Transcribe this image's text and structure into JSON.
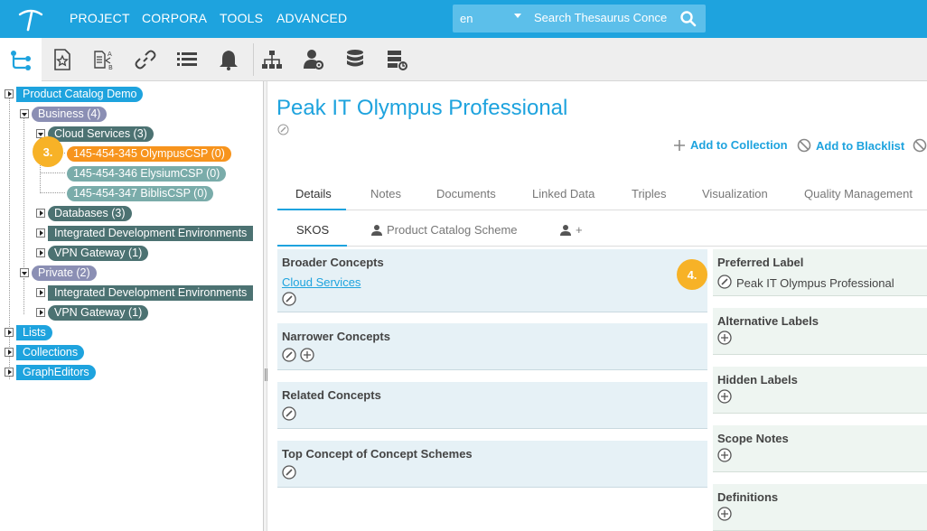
{
  "topbar": {
    "nav": [
      "PROJECT",
      "CORPORA",
      "TOOLS",
      "ADVANCED"
    ],
    "language": "en",
    "search_placeholder": "Search Thesaurus Conce"
  },
  "toolbar": {
    "tools": [
      "hierarchy-icon",
      "star-document-icon",
      "abc-document-icon",
      "link-icon",
      "list-icon",
      "bell-icon",
      "org-chart-icon",
      "user-settings-icon",
      "database-icon",
      "server-icon"
    ]
  },
  "tree": {
    "root": "Product Catalog Demo",
    "business": "Business (4)",
    "cloud_services": "Cloud Services (3)",
    "olympus": "145-454-345 OlympusCSP (0)",
    "elysium": "145-454-346 ElysiumCSP (0)",
    "biblis": "145-454-347 BiblisCSP (0)",
    "databases": "Databases (3)",
    "ide_business": "Integrated Development Environments",
    "vpn_business": "VPN Gateway (1)",
    "private": "Private (2)",
    "ide_private": "Integrated Development Environments",
    "vpn_private": "VPN Gateway (1)",
    "lists": "Lists",
    "collections": "Collections",
    "grapheditors": "GraphEditors"
  },
  "badges": {
    "step3": "3.",
    "step4": "4."
  },
  "concept": {
    "title": "Peak IT Olympus Professional",
    "add_collection": "Add to Collection",
    "add_blacklist": "Add to Blacklist"
  },
  "tabs": [
    "Details",
    "Notes",
    "Documents",
    "Linked Data",
    "Triples",
    "Visualization",
    "Quality Management"
  ],
  "subtabs": {
    "skos": "SKOS",
    "scheme": "Product Catalog Scheme",
    "plus": "+"
  },
  "left_cards": {
    "broader": "Broader Concepts",
    "broader_link": "Cloud Services",
    "narrower": "Narrower Concepts",
    "related": "Related Concepts",
    "top_concept": "Top Concept of Concept Schemes"
  },
  "right_cards": {
    "preferred": "Preferred Label",
    "preferred_value": "Peak IT Olympus Professional",
    "alternative": "Alternative Labels",
    "hidden": "Hidden Labels",
    "scope": "Scope Notes",
    "definitions": "Definitions"
  },
  "colors": {
    "brand": "#1ea3de",
    "selected": "#f7941d",
    "badge": "#f7b227"
  }
}
